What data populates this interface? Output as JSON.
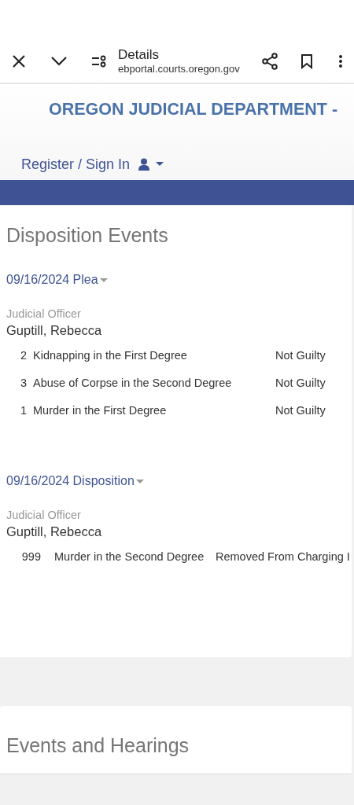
{
  "browser_bar": {
    "title": "Details",
    "url": "ebportal.courts.oregon.gov"
  },
  "site_header": {
    "title": "OREGON JUDICIAL DEPARTMENT -",
    "account_link": "Register / Sign In"
  },
  "disposition_events": {
    "heading": "Disposition Events",
    "events": [
      {
        "label": "09/16/2024 Plea",
        "officer_label": "Judicial Officer",
        "officer": "Guptill, Rebecca",
        "charges": [
          {
            "number": "2",
            "charge": "Kidnapping in the First Degree",
            "result": "Not Guilty"
          },
          {
            "number": "3",
            "charge": "Abuse of Corpse in the Second Degree",
            "result": "Not Guilty"
          },
          {
            "number": "1",
            "charge": "Murder in the First Degree",
            "result": "Not Guilty"
          }
        ]
      },
      {
        "label": "09/16/2024 Disposition",
        "officer_label": "Judicial Officer",
        "officer": "Guptill, Rebecca",
        "charges": [
          {
            "number": "999",
            "charge": "Murder in the Second Degree",
            "result": "Removed From Charging I"
          }
        ]
      }
    ]
  },
  "events_and_hearings": {
    "heading": "Events and Hearings"
  }
}
